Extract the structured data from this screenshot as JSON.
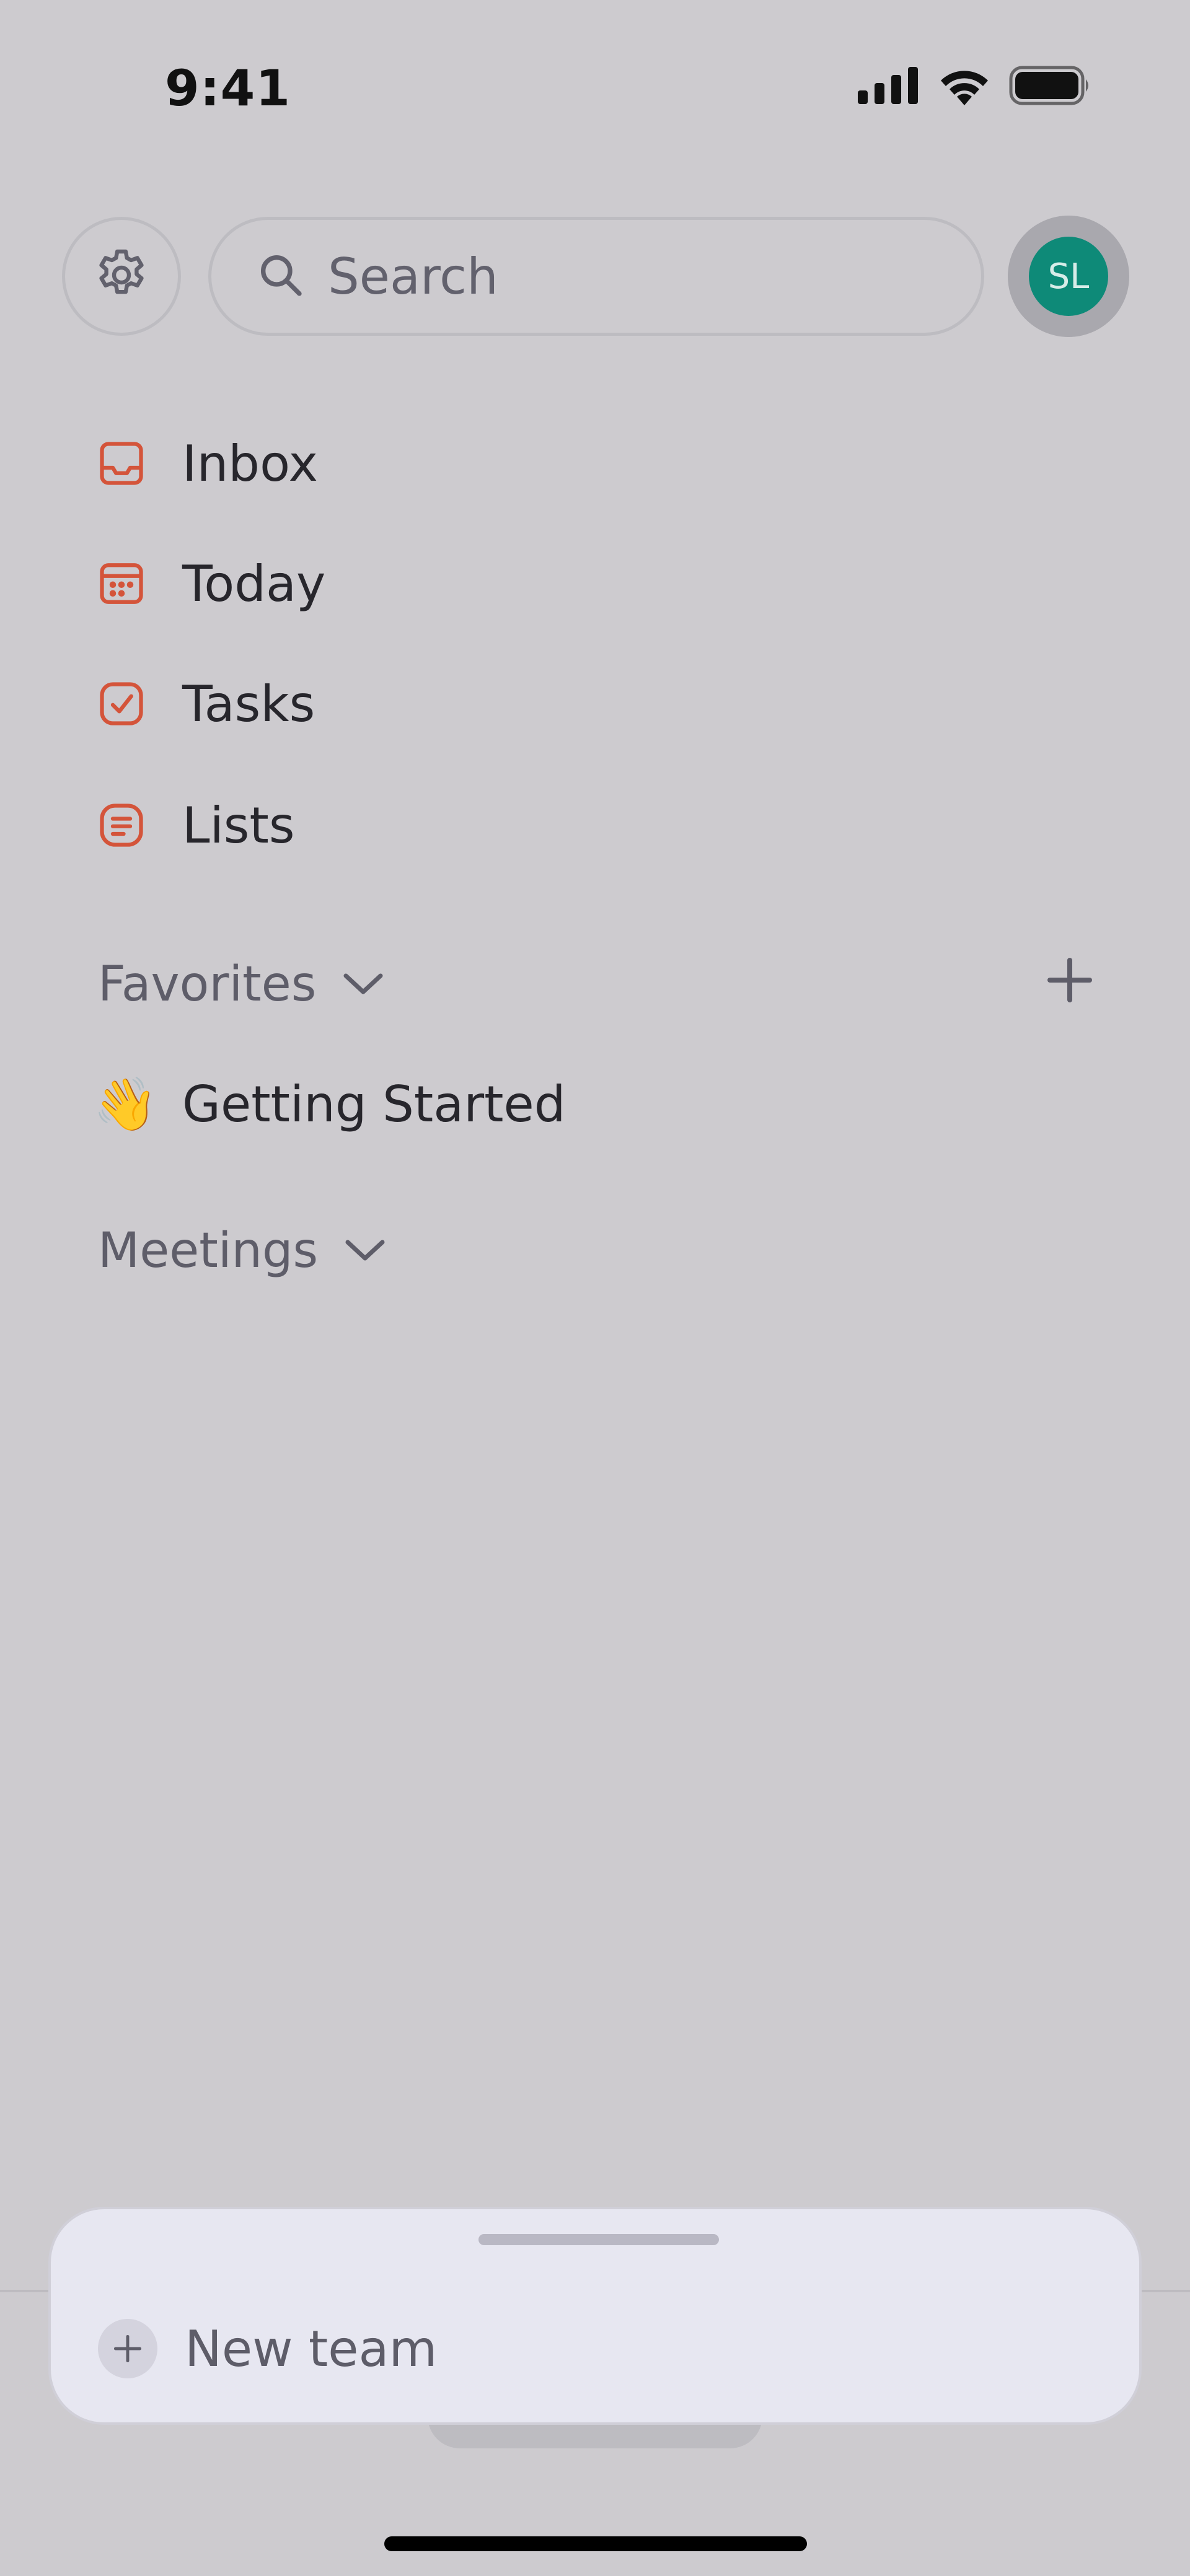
{
  "status_bar": {
    "time": "9:41",
    "icons": [
      "cellular-signal-icon",
      "wifi-icon",
      "battery-icon"
    ]
  },
  "header": {
    "settings_icon": "gear-icon",
    "search_placeholder": "Search",
    "avatar_initials": "SL",
    "avatar_color": "#0e8a78"
  },
  "nav": {
    "accent_color": "#d4543a",
    "items": [
      {
        "label": "Inbox",
        "icon": "inbox-icon"
      },
      {
        "label": "Today",
        "icon": "calendar-icon"
      },
      {
        "label": "Tasks",
        "icon": "checkbox-icon"
      },
      {
        "label": "Lists",
        "icon": "list-icon"
      }
    ]
  },
  "favorites": {
    "label": "Favorites",
    "items": [
      {
        "emoji": "👋",
        "label": "Getting Started"
      }
    ]
  },
  "meetings": {
    "label": "Meetings"
  },
  "sheet": {
    "new_team_label": "New team"
  }
}
